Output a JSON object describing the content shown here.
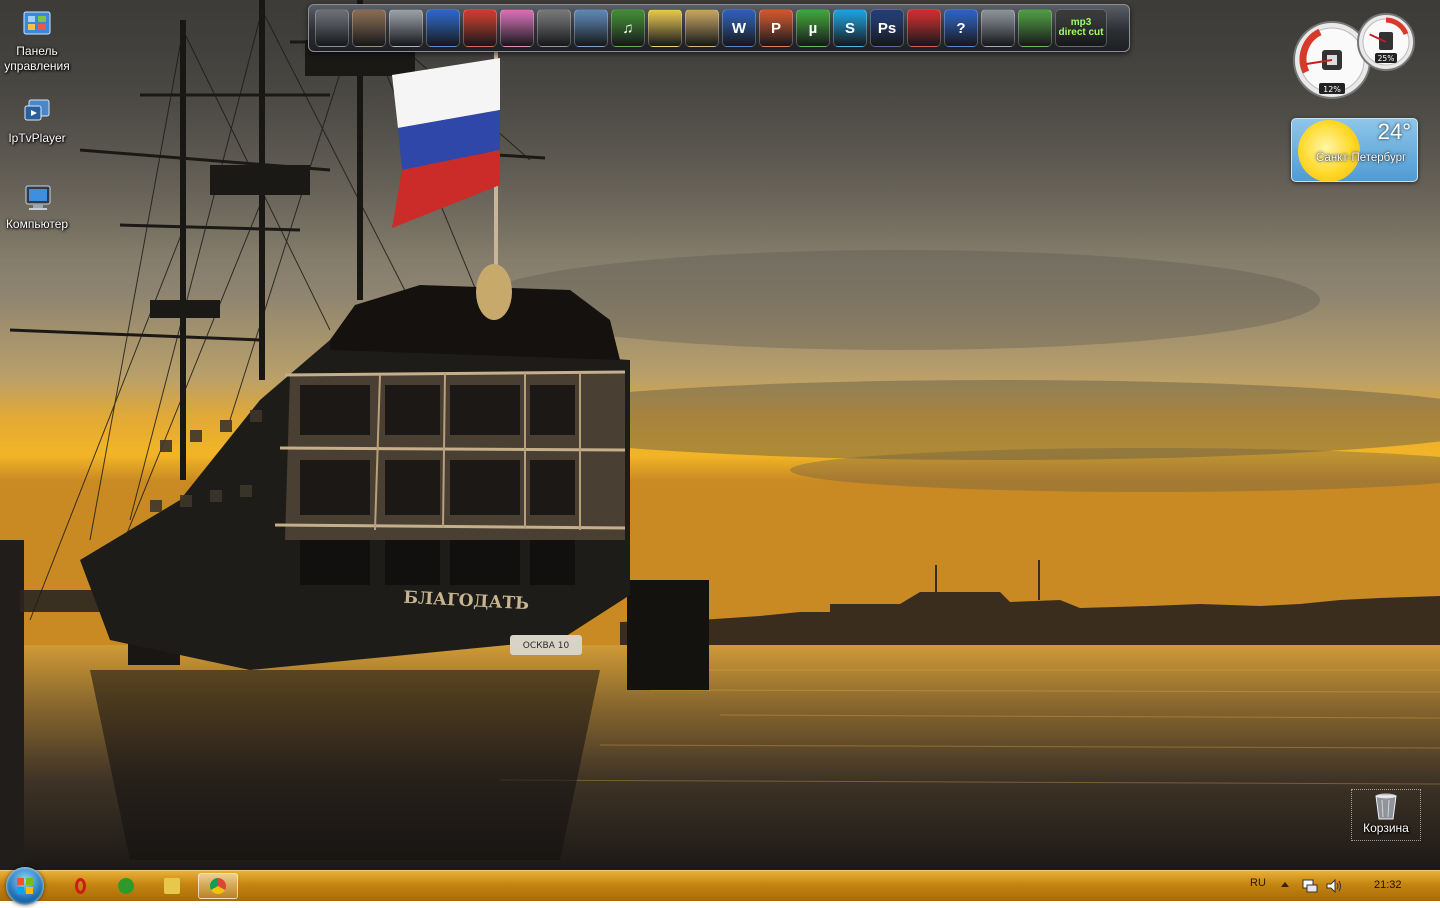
{
  "desktop": {
    "icons": [
      {
        "label": "Панель управления",
        "icon": "control-panel-icon"
      },
      {
        "label": "IpTvPlayer",
        "icon": "iptv-player-icon"
      },
      {
        "label": "Компьютер",
        "icon": "computer-icon"
      },
      {
        "label": "Корзина",
        "icon": "recycle-bin-icon"
      }
    ],
    "ship_name": "БЛАГОДАТЬ",
    "boat_text": "ОСКВА 10"
  },
  "dock": {
    "items": [
      {
        "icon": "shield-app-icon",
        "color": "#6b6f75",
        "text": ""
      },
      {
        "icon": "game-portrait-icon",
        "color": "#8a6b4f",
        "text": ""
      },
      {
        "icon": "knight-game-icon",
        "color": "#9aa0a8",
        "text": ""
      },
      {
        "icon": "globe-app-icon",
        "color": "#2a66c9",
        "text": ""
      },
      {
        "icon": "counter-strike-icon",
        "color": "#d23a28",
        "text": ""
      },
      {
        "icon": "girl-game-icon",
        "color": "#d96fb6",
        "text": ""
      },
      {
        "icon": "movie-maker-icon",
        "color": "#777777",
        "text": ""
      },
      {
        "icon": "photo-viewer-icon",
        "color": "#5c87b8",
        "text": ""
      },
      {
        "icon": "music-note-icon",
        "color": "#3f8f2f",
        "text": "♫"
      },
      {
        "icon": "folder-icon",
        "color": "#e8c84c",
        "text": ""
      },
      {
        "icon": "archive-app-icon",
        "color": "#c7a45e",
        "text": ""
      },
      {
        "icon": "word-icon",
        "color": "#2c5fb8",
        "text": "W"
      },
      {
        "icon": "powerpoint-icon",
        "color": "#d2562b",
        "text": "P"
      },
      {
        "icon": "utorrent-icon",
        "color": "#3fa535",
        "text": "µ"
      },
      {
        "icon": "skype-icon",
        "color": "#1aa2e0",
        "text": "S"
      },
      {
        "icon": "photoshop-icon",
        "color": "#1f3d7a",
        "text": "Ps"
      },
      {
        "icon": "radio-app-icon",
        "color": "#d42a2a",
        "text": ""
      },
      {
        "icon": "help-icon",
        "color": "#2a62c6",
        "text": "?"
      },
      {
        "icon": "webcam-app-icon",
        "color": "#8d929a",
        "text": ""
      },
      {
        "icon": "cash-app-icon",
        "color": "#4c9e3d",
        "text": ""
      },
      {
        "icon": "mp3-directcut-icon",
        "color": "#3a3a3a",
        "text": "mp3 direct cut"
      }
    ]
  },
  "gadgets": {
    "cpu_meter": {
      "cpu": "12%",
      "memory": "25%",
      "cpu_value": 12,
      "memory_value": 25
    },
    "weather": {
      "temperature": "24°",
      "city": "Санкт-Петербург"
    }
  },
  "taskbar": {
    "buttons": [
      {
        "icon": "opera-icon",
        "color": "#d41818"
      },
      {
        "icon": "utorrent-icon",
        "color": "#2f9a2a"
      },
      {
        "icon": "file-explorer-icon",
        "color": "#e8c84c"
      },
      {
        "icon": "chrome-icon",
        "color": "#2f9a2a",
        "active": true
      }
    ],
    "language": "RU",
    "time": "21:32",
    "tray_icons": [
      "show-hidden-icons-arrow",
      "network-icon",
      "volume-icon"
    ]
  }
}
